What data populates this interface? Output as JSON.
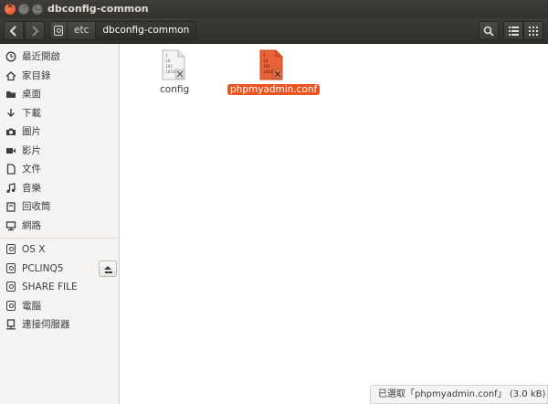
{
  "window": {
    "title": "dbconfig-common"
  },
  "toolbar": {
    "back_icon": "chevron-left-icon",
    "forward_icon": "chevron-right-icon",
    "path": [
      "etc",
      "dbconfig-common"
    ]
  },
  "sidebar": {
    "places": [
      {
        "label": "最近開啟",
        "icon": "clock-icon"
      },
      {
        "label": "家目錄",
        "icon": "home-icon"
      },
      {
        "label": "桌面",
        "icon": "folder-icon"
      },
      {
        "label": "下載",
        "icon": "download-icon"
      },
      {
        "label": "圖片",
        "icon": "camera-icon"
      },
      {
        "label": "影片",
        "icon": "film-icon"
      },
      {
        "label": "文件",
        "icon": "document-icon"
      },
      {
        "label": "音樂",
        "icon": "music-icon"
      },
      {
        "label": "回收筒",
        "icon": "trash-icon"
      },
      {
        "label": "網路",
        "icon": "network-icon"
      }
    ],
    "devices": [
      {
        "label": "OS X",
        "icon": "drive-icon"
      },
      {
        "label": "PCLINQ5",
        "icon": "drive-icon"
      },
      {
        "label": "SHARE FILE",
        "icon": "drive-icon"
      },
      {
        "label": "電腦",
        "icon": "drive-icon"
      },
      {
        "label": "連接伺服器",
        "icon": "server-icon"
      }
    ]
  },
  "files": [
    {
      "name": "config",
      "selected": false
    },
    {
      "name": "phpmyadmin.conf",
      "selected": true
    }
  ],
  "status": {
    "text": "已選取「phpmyadmin.conf」 (3.0 kB)"
  },
  "colors": {
    "accent": "#e95420",
    "titlebar": "#3c3b37"
  }
}
